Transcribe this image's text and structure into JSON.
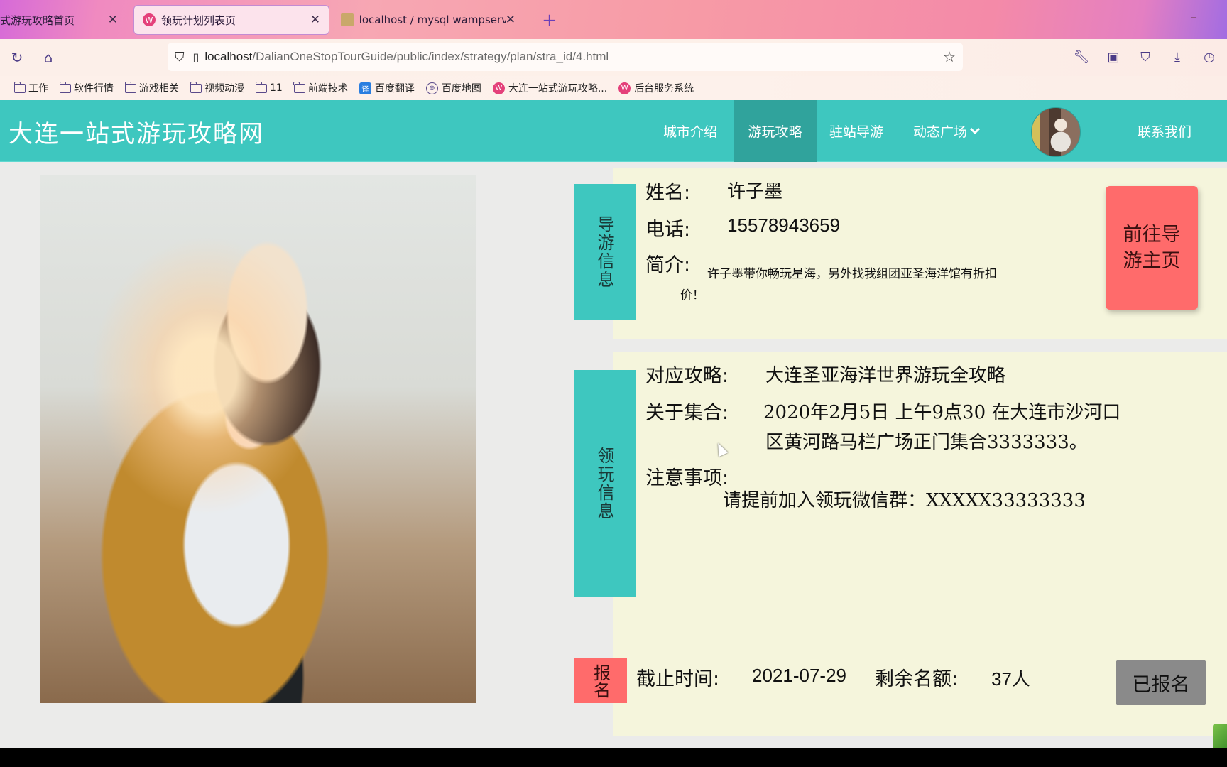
{
  "browser": {
    "tabs": [
      {
        "label": "式游玩攻略首页",
        "active": false
      },
      {
        "label": "领玩计划列表页",
        "active": true
      },
      {
        "label": "localhost / mysql wampserve",
        "active": false
      }
    ],
    "new_tab_label": "+",
    "minimize_label": "–",
    "url_host": "localhost",
    "url_path": "/DalianOneStopTourGuide/public/index/strategy/plan/stra_id/4.html",
    "bookmarks": [
      {
        "label": "工作",
        "type": "folder"
      },
      {
        "label": "软件行情",
        "type": "folder"
      },
      {
        "label": "游戏相关",
        "type": "folder"
      },
      {
        "label": "视频动漫",
        "type": "folder"
      },
      {
        "label": "11",
        "type": "folder"
      },
      {
        "label": "前端技术",
        "type": "folder"
      },
      {
        "label": "百度翻译",
        "type": "site"
      },
      {
        "label": "百度地图",
        "type": "site"
      },
      {
        "label": "大连一站式游玩攻略...",
        "type": "site"
      },
      {
        "label": "后台服务系统",
        "type": "site"
      }
    ]
  },
  "site": {
    "title": "大连一站式游玩攻略网",
    "nav": [
      {
        "label": "城市介绍",
        "active": false
      },
      {
        "label": "游玩攻略",
        "active": true
      },
      {
        "label": "驻站导游",
        "active": false
      },
      {
        "label": "动态广场",
        "active": false,
        "dropdown": true
      },
      {
        "label": "联系我们",
        "active": false
      }
    ],
    "colors": {
      "primary": "#3ec7bf",
      "nav_active": "#30a39c",
      "accent_red": "#ff6b6b",
      "card_bg": "#f5f5dc",
      "disabled_btn": "#8a8a8a"
    }
  },
  "guide_info": {
    "side_label": "导游信息",
    "name_label": "姓名:",
    "name_value": "许子墨",
    "phone_label": "电话:",
    "phone_value": "15578943659",
    "intro_label": "简介:",
    "intro_value": "许子墨带你畅玩星海，另外找我组团亚圣海洋馆有折扣价！",
    "goto_button": "前往导游主页"
  },
  "plan_info": {
    "side_label": "领玩信息",
    "strategy_label": "对应攻略:",
    "strategy_value": "大连圣亚海洋世界游玩全攻略",
    "meet_label": "关于集合:",
    "meet_line1": "2020年2月5日  上午9点30  在大连市沙河口",
    "meet_line2": "区黄河路马栏广场正门集合3333333。",
    "notes_label": "注意事项:",
    "notes_value": "请提前加入领玩微信群：XXXXX33333333"
  },
  "signup": {
    "side_label": "报名",
    "deadline_label": "截止时间:",
    "deadline_value": "2021-07-29",
    "remaining_label": "剩余名额:",
    "remaining_value": "37人",
    "button_label": "已报名"
  }
}
